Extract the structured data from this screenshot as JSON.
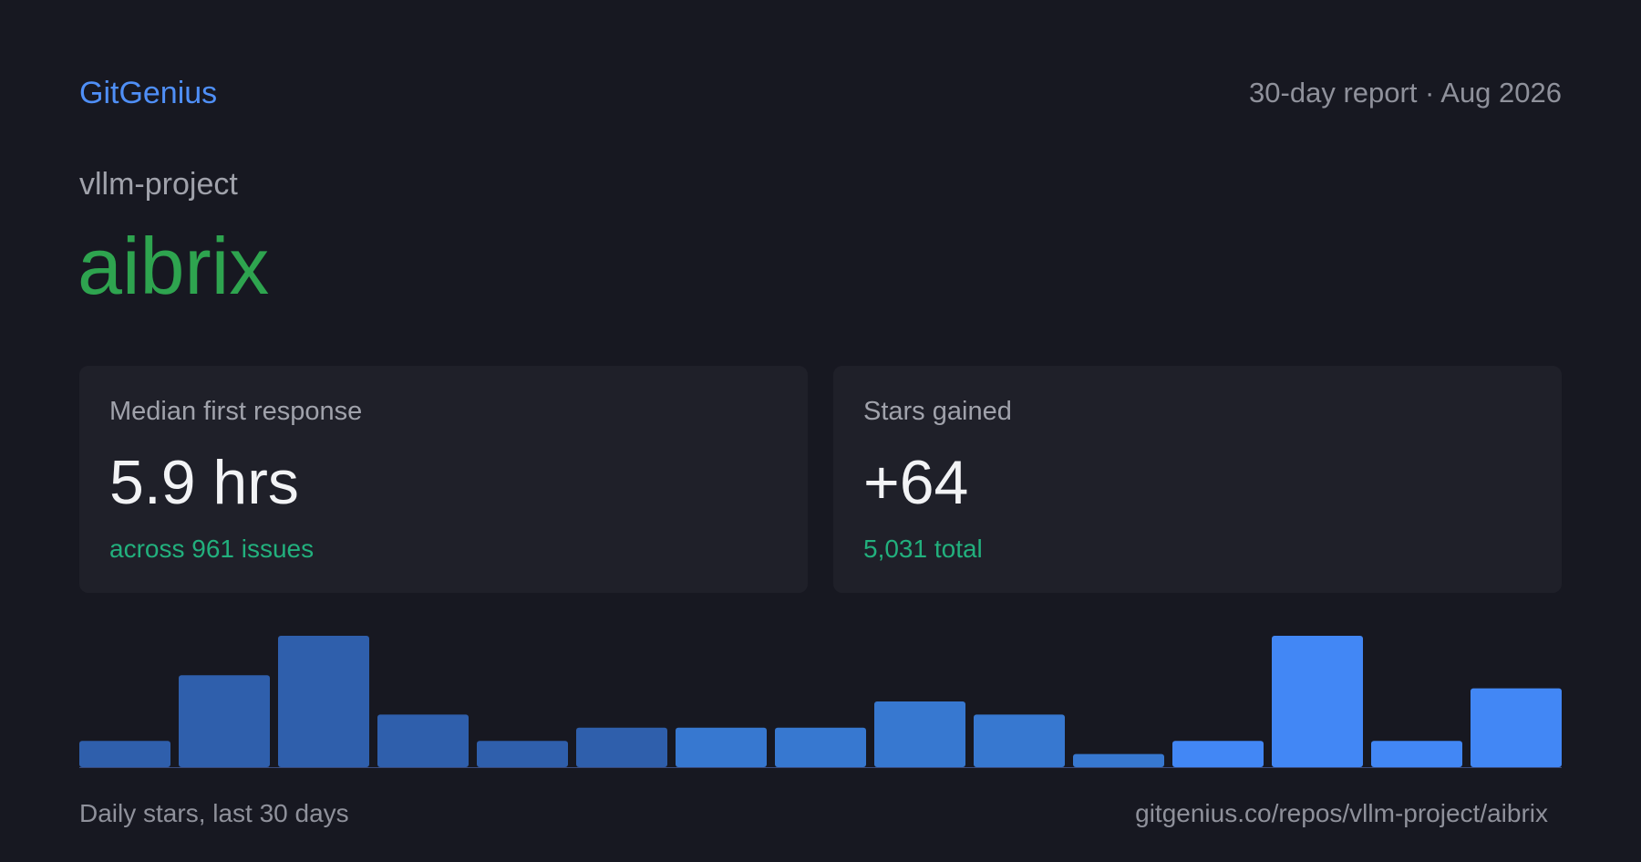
{
  "header": {
    "brand": "GitGenius",
    "report_period": "30-day report · Aug 2026"
  },
  "repo": {
    "owner": "vllm-project",
    "name": "aibrix"
  },
  "cards": [
    {
      "label": "Median first response",
      "value": "5.9 hrs",
      "sub": "across 961 issues"
    },
    {
      "label": "Stars gained",
      "value": "+64",
      "sub": "5,031 total"
    }
  ],
  "footer": {
    "caption": "Daily stars, last 30 days",
    "url": "gitgenius.co/repos/vllm-project/aibrix"
  },
  "colors": {
    "background": "#171821",
    "card": "#1f2029",
    "brand": "#4f8ff7",
    "repo_name": "#2ea44f",
    "sub_text": "#22b07d",
    "bar_old": "#2f5fac",
    "bar_mid": "#3778d0",
    "bar_recent": "#4287f5"
  },
  "chart_data": {
    "type": "bar",
    "values": [
      2,
      7,
      10,
      4,
      2,
      3,
      3,
      3,
      5,
      4,
      1,
      2,
      10,
      2,
      6
    ],
    "ylim": [
      0,
      10
    ],
    "grid": false
  }
}
